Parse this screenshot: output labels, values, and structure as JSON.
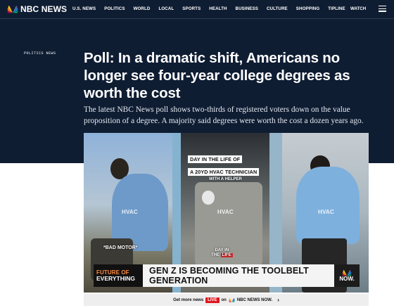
{
  "nav": {
    "logo": "NBC NEWS",
    "links": [
      "U.S. NEWS",
      "POLITICS",
      "WORLD",
      "LOCAL",
      "SPORTS",
      "HEALTH",
      "BUSINESS",
      "CULTURE",
      "SHOPPING",
      "TIPLINE"
    ],
    "watch": "WATCH",
    "menu_icon": "hamburger-menu-icon"
  },
  "article": {
    "section": "POLITICS NEWS",
    "headline": "Poll: In a dramatic shift, Americans no longer see four-year college degrees as worth the cost",
    "dek": "The latest NBC News poll shows two-thirds of registered voters down on the value proposition of a degree. A majority said degrees were worth the cost a dozen years ago."
  },
  "video": {
    "caption_line1": "DAY IN THE LIFE OF",
    "caption_line2": "A 20YD HVAC TECHNICIAN",
    "caption_sub": "WITH A HELPER",
    "watermark": "HVAC",
    "bad_motor": "*BAD MOTOR*",
    "day_in": "DAY IN",
    "the_life_1": "THE",
    "the_life_2": "LIFE",
    "brand_line1": "FUTURE OF",
    "brand_line2": "EVERYTHING",
    "lower_title": "GEN Z IS BECOMING THE TOOLBELT GENERATION",
    "now_label": "NOW."
  },
  "promo": {
    "prefix": "Get more news",
    "live": "LIVE",
    "on": "on",
    "brand": "NBC NEWS NOW.",
    "chevron_icon": "chevron-right-icon"
  },
  "colors": {
    "hero_bg": "#0f1d33",
    "live_red": "#e0161f",
    "future_orange": "#ff8a3d"
  }
}
